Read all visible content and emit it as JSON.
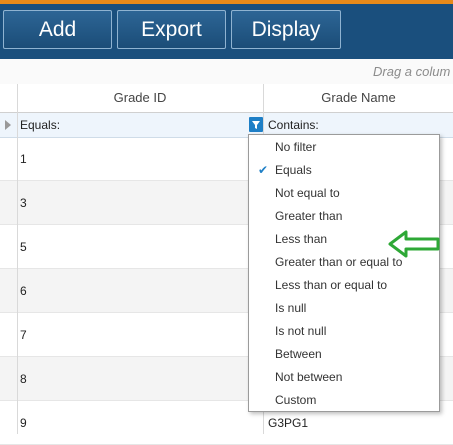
{
  "toolbar": {
    "add_label": "Add",
    "export_label": "Export",
    "display_label": "Display",
    "background_color": "#1a4f7d",
    "accent_color": "#e88a1a"
  },
  "group_hint": "Drag a colum",
  "grid": {
    "columns": [
      "Grade ID",
      "Grade Name"
    ],
    "filter": {
      "grade_id_operator": "Equals:",
      "grade_name_operator": "Contains:"
    },
    "rows": [
      {
        "grade_id": "1",
        "grade_name": ""
      },
      {
        "grade_id": "3",
        "grade_name": ""
      },
      {
        "grade_id": "5",
        "grade_name": ""
      },
      {
        "grade_id": "6",
        "grade_name": ""
      },
      {
        "grade_id": "7",
        "grade_name": ""
      },
      {
        "grade_id": "8",
        "grade_name": ""
      },
      {
        "grade_id": "9",
        "grade_name": "G3PG1"
      }
    ]
  },
  "filter_menu": {
    "selected": "Equals",
    "items": [
      "No filter",
      "Equals",
      "Not equal to",
      "Greater than",
      "Less than",
      "Greater than or equal to",
      "Less than or equal to",
      "Is null",
      "Is not null",
      "Between",
      "Not between",
      "Custom"
    ],
    "annotation_icon": "green-arrow-icon",
    "annotation_color": "#2ea836"
  }
}
